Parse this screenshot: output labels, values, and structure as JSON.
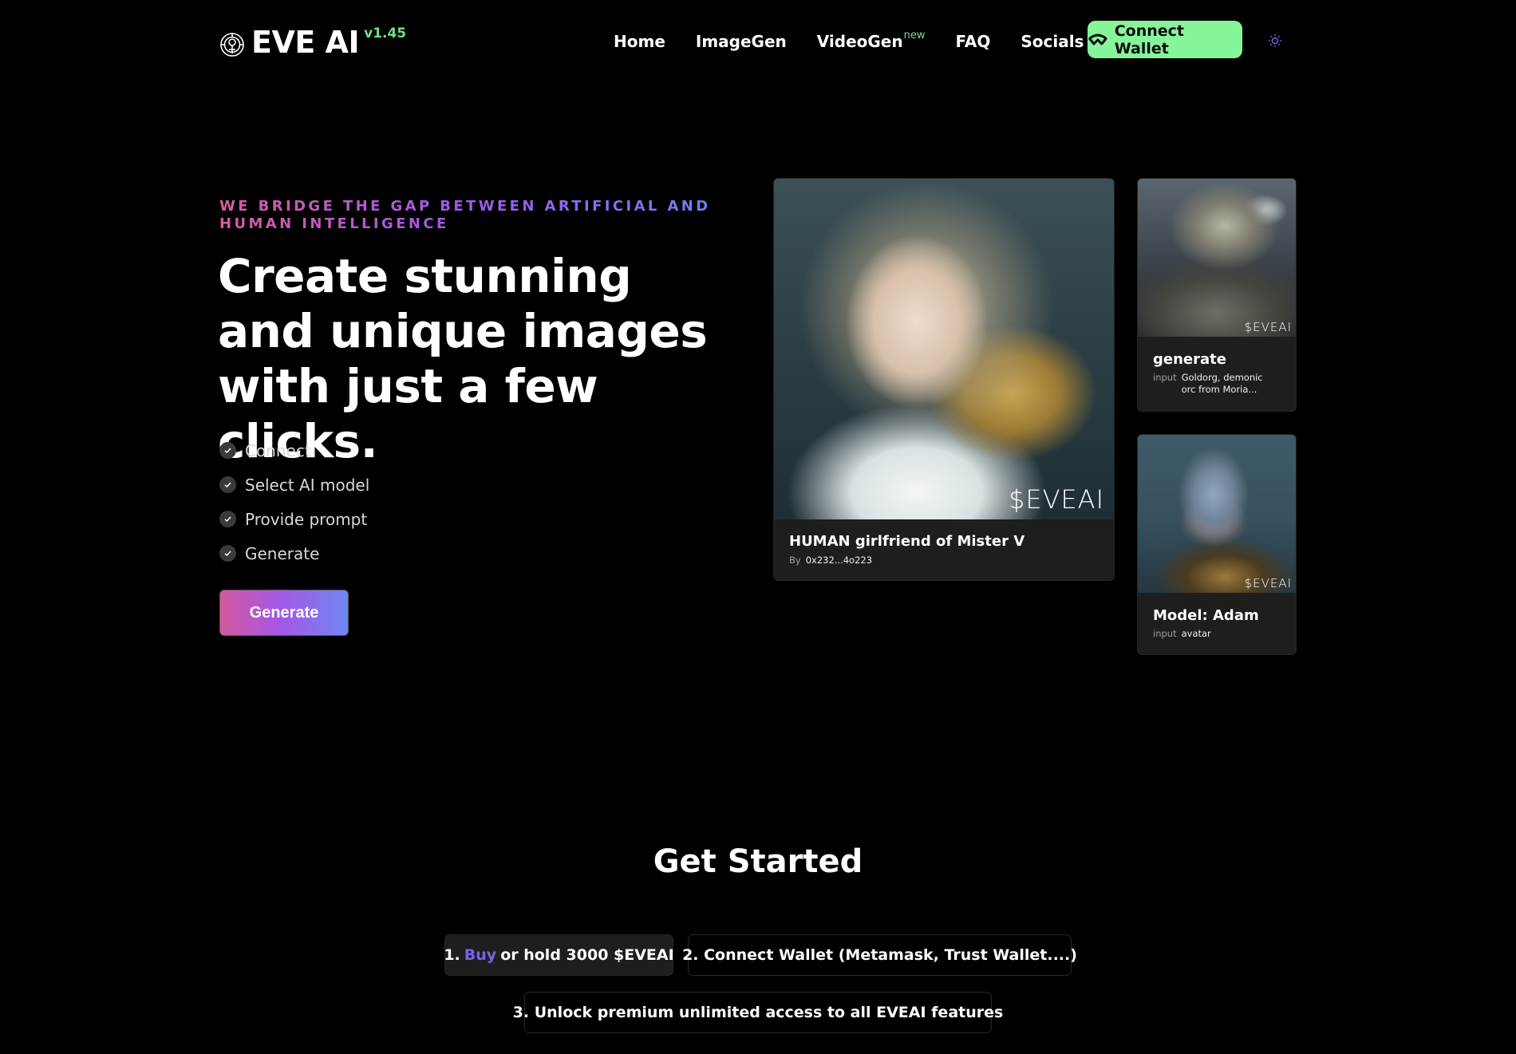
{
  "header": {
    "brand": "EVE AI",
    "version": "v1.45",
    "logo_icon": "eve-ai-logo-icon",
    "nav": [
      {
        "label": "Home"
      },
      {
        "label": "ImageGen"
      },
      {
        "label": "VideoGen",
        "badge": "new"
      },
      {
        "label": "FAQ"
      },
      {
        "label": "Socials",
        "icon": "chevron-down-icon"
      }
    ],
    "connect_wallet": {
      "label": "Connect Wallet",
      "icon": "walletconnect-icon"
    },
    "theme_toggle_icon": "sun-icon"
  },
  "hero": {
    "eyebrow": "WE BRIDGE THE GAP BETWEEN ARTIFICIAL AND HUMAN INTELLIGENCE",
    "headline": "Create stunning and unique images with just a few clicks.",
    "steps": [
      {
        "label": "Connect",
        "icon": "check-icon"
      },
      {
        "label": "Select AI model",
        "icon": "check-icon"
      },
      {
        "label": "Provide prompt",
        "icon": "check-icon"
      },
      {
        "label": "Generate",
        "icon": "check-icon"
      }
    ],
    "generate_button": "Generate"
  },
  "gallery": {
    "main": {
      "watermark": "$EVEAI",
      "title": "HUMAN girlfriend of Mister V",
      "meta_label": "By",
      "meta_value": "0x232...4o223"
    },
    "cards": [
      {
        "watermark": "$EVEAI",
        "title": "generate",
        "meta_label": "input",
        "meta_value": "Goldorg, demonic orc from Moria..."
      },
      {
        "watermark": "$EVEAI",
        "title": "Model: Adam",
        "meta_label": "input",
        "meta_value": "avatar"
      }
    ]
  },
  "get_started": {
    "title": "Get Started",
    "step1": {
      "prefix": "1.",
      "link": "Buy",
      "suffix": "or hold 3000 $EVEAI"
    },
    "step2": "2. Connect Wallet (Metamask, Trust Wallet....)",
    "step3": "3. Unlock premium unlimited access to all EVEAI features"
  },
  "colors": {
    "background": "#000000",
    "accent_green": "#86f59a",
    "version_green": "#6fe08a",
    "gradient_start": "#d45a9e",
    "gradient_mid": "#a656e6",
    "gradient_end": "#6f86f2",
    "link_purple": "#7b62ea",
    "card_bg": "#1e1e1e"
  }
}
